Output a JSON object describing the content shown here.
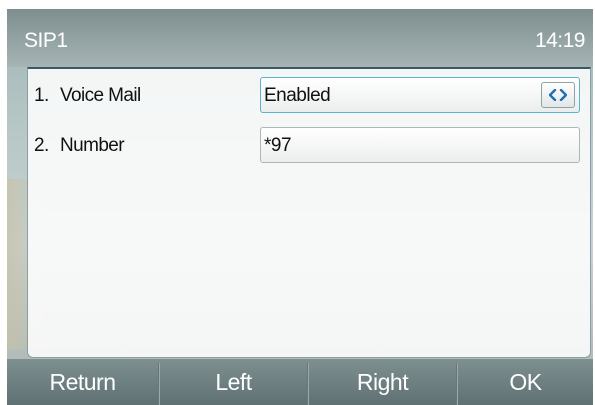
{
  "status_bar": {
    "title": "SIP1",
    "time": "14:19"
  },
  "rows": [
    {
      "index": "1.",
      "label": "Voice Mail",
      "value": "Enabled",
      "control": "left-right-arrows-icon"
    },
    {
      "index": "2.",
      "label": "Number",
      "value": "*97"
    }
  ],
  "softkeys": [
    "Return",
    "Left",
    "Right",
    "OK"
  ],
  "colors": {
    "status_bar": "#8e9d9e",
    "active_border": "#59b3c9",
    "arrow_icon": "#1f6fb1",
    "softkey_bar": "#6e8082"
  }
}
